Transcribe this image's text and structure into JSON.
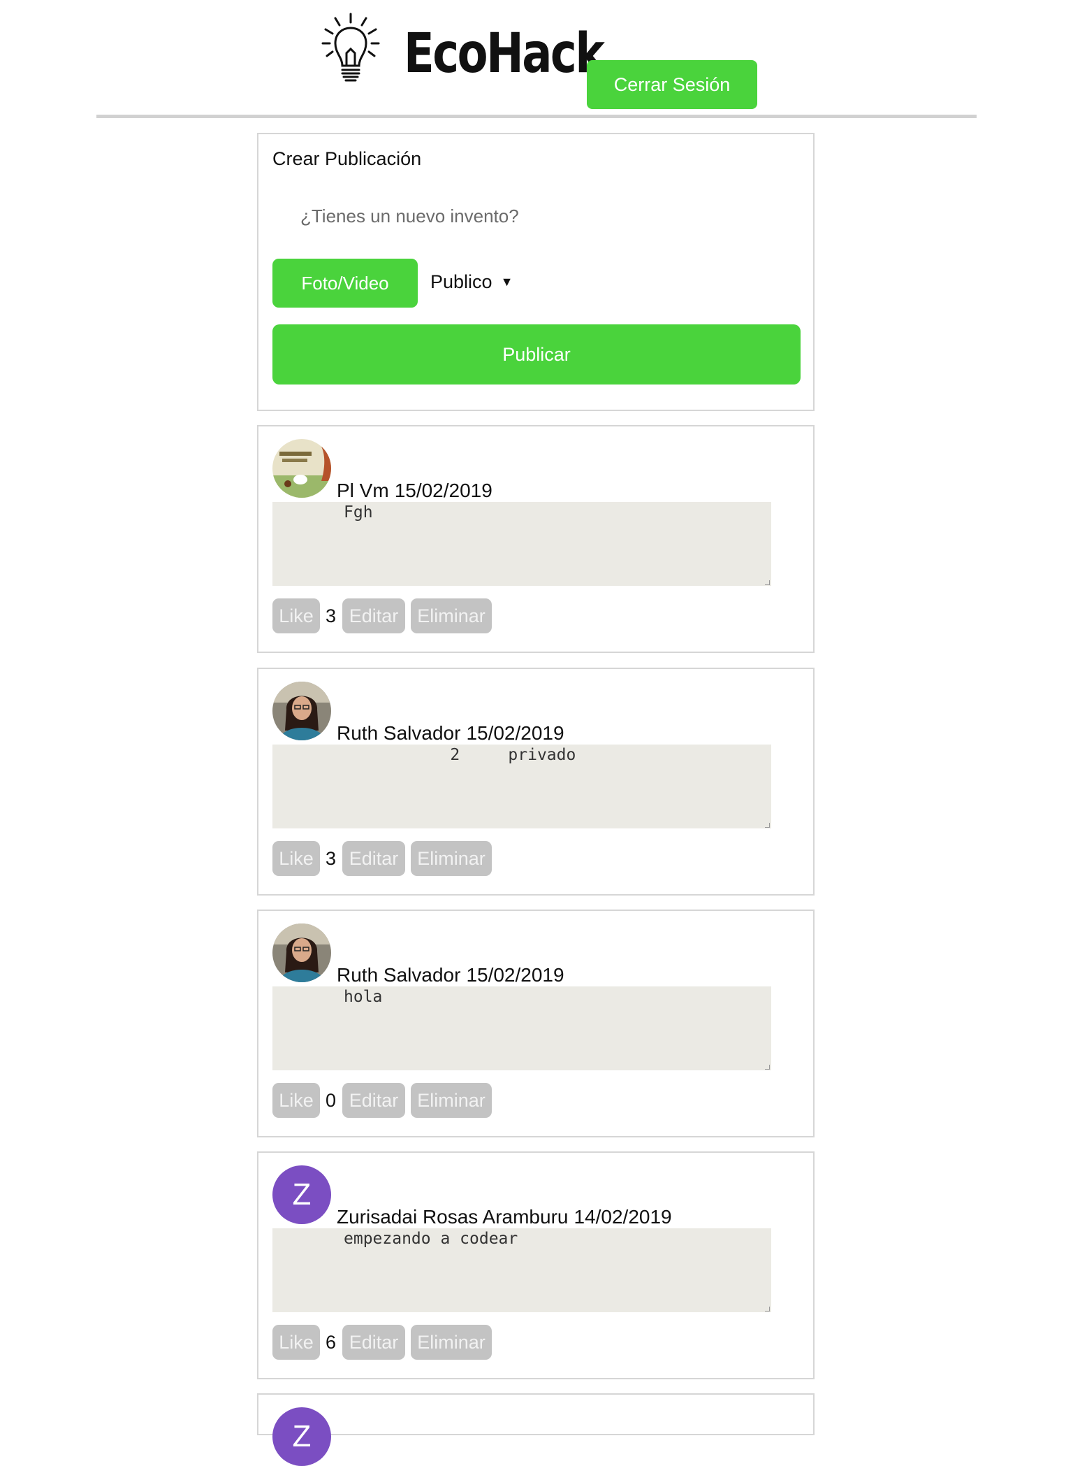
{
  "header": {
    "brand": "EcoHack",
    "logo_icon": "lightbulb-icon",
    "logout_label": "Cerrar Sesión"
  },
  "composer": {
    "title": "Crear Publicación",
    "placeholder": "¿Tienes un nuevo invento?",
    "media_label": "Foto/Video",
    "privacy_label": "Publico",
    "privacy_arrow": "▼",
    "publish_label": "Publicar"
  },
  "posts": [
    {
      "author": "Pl Vm",
      "date": "15/02/2019",
      "body": "Fgh",
      "likes": "3",
      "like_label": "Like",
      "edit_label": "Editar",
      "delete_label": "Eliminar",
      "avatar": "photo"
    },
    {
      "author": "Ruth Salvador",
      "date": "15/02/2019",
      "body": "           2     privado",
      "likes": "3",
      "like_label": "Like",
      "edit_label": "Editar",
      "delete_label": "Eliminar",
      "avatar": "photo"
    },
    {
      "author": "Ruth Salvador",
      "date": "15/02/2019",
      "body": "hola",
      "likes": "0",
      "like_label": "Like",
      "edit_label": "Editar",
      "delete_label": "Eliminar",
      "avatar": "photo"
    },
    {
      "author": "Zurisadai Rosas Aramburu",
      "date": "14/02/2019",
      "body": "empezando a codear",
      "likes": "6",
      "like_label": "Like",
      "edit_label": "Editar",
      "delete_label": "Eliminar",
      "avatar_letter": "Z"
    },
    {
      "avatar_letter": "Z"
    }
  ],
  "colors": {
    "accent_green": "#4ad33c",
    "button_gray": "#c3c3c3",
    "avatar_purple": "#7b4ec2",
    "textarea_bg": "#ebeae4"
  }
}
